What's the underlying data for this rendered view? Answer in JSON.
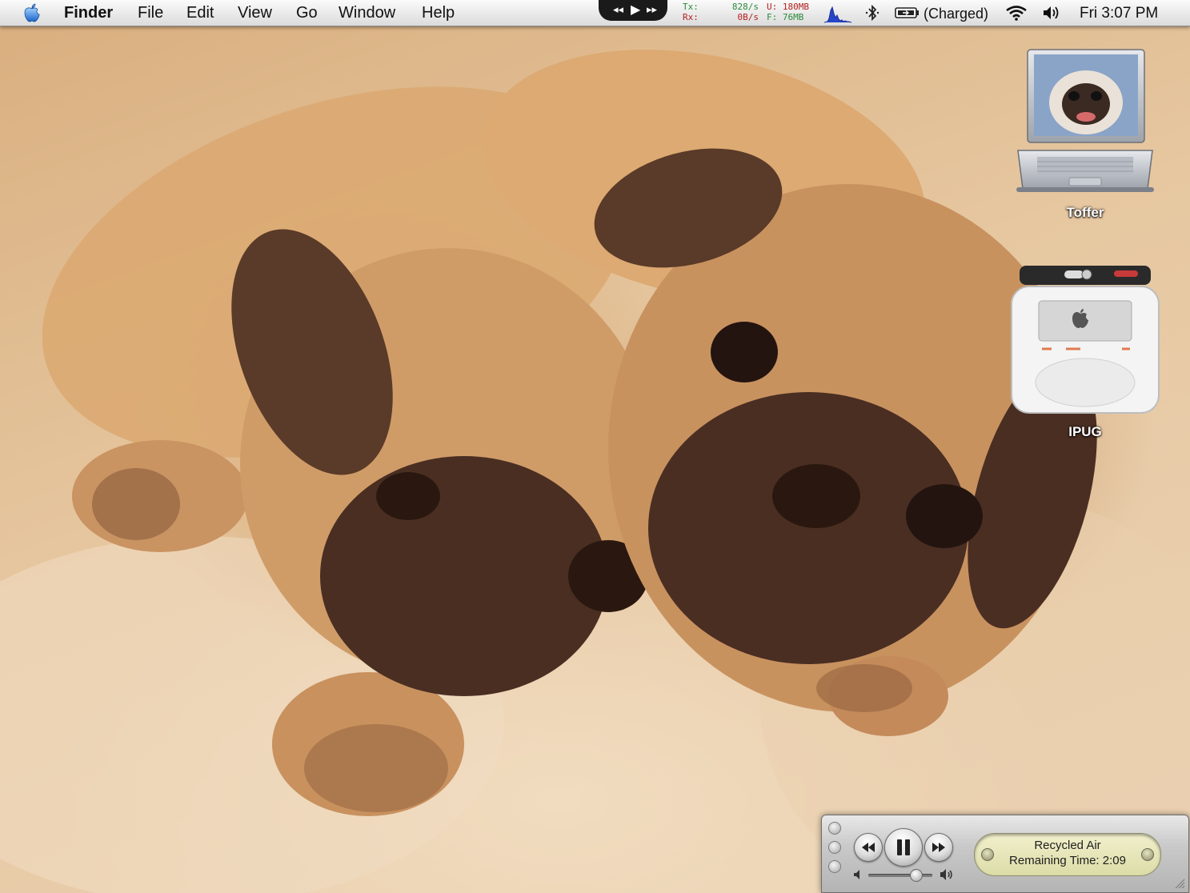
{
  "menubar": {
    "apple_icon": "apple-icon",
    "app_name": "Finder",
    "menus": [
      "File",
      "Edit",
      "View",
      "Go",
      "Window",
      "Help"
    ],
    "network": {
      "tx_label": "Tx:",
      "tx_value": "828/s",
      "rx_label": "Rx:",
      "rx_value": "0B/s"
    },
    "memory": {
      "used": "U: 180MB",
      "free": "F:  76MB"
    },
    "battery_status": "(Charged)",
    "clock": "Fri 3:07 PM",
    "colors": {
      "tx_green": "#2a8a3a",
      "rx_red": "#b42020",
      "cpu_graph_blue": "#2844c8"
    }
  },
  "desktop": {
    "icons": [
      {
        "label": "Toffer",
        "icon": "powerbook-icon"
      },
      {
        "label": "IPUG",
        "icon": "ipod-icon"
      }
    ]
  },
  "mini_player": {
    "track_title": "Recycled Air",
    "remaining_label": "Remaining Time:",
    "remaining_value": "2:09",
    "volume_level": 0.75
  }
}
